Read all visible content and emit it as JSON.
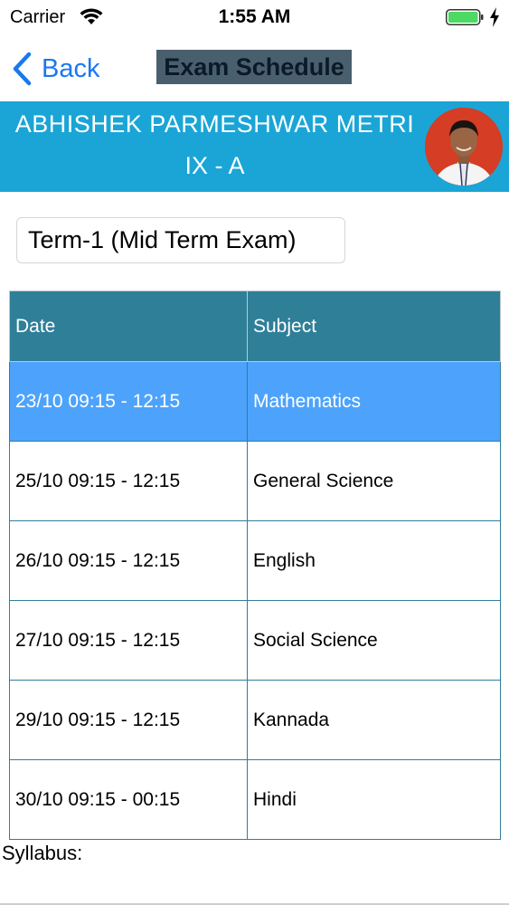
{
  "status_bar": {
    "carrier": "Carrier",
    "time": "1:55 AM"
  },
  "nav": {
    "back_label": "Back",
    "title": "Exam Schedule"
  },
  "profile": {
    "name": "ABHISHEK PARMESHWAR METRI",
    "class_section": "IX - A"
  },
  "term": {
    "selected": "Term-1 (Mid Term Exam)"
  },
  "table": {
    "headers": [
      "Date",
      "Subject"
    ],
    "rows": [
      {
        "date": "23/10 09:15 - 12:15",
        "subject": "Mathematics"
      },
      {
        "date": "25/10 09:15 - 12:15",
        "subject": "General Science"
      },
      {
        "date": "26/10 09:15 - 12:15",
        "subject": "English"
      },
      {
        "date": "27/10 09:15 - 12:15",
        "subject": "Social Science"
      },
      {
        "date": "29/10 09:15 - 12:15",
        "subject": "Kannada"
      },
      {
        "date": "30/10 09:15 - 00:15",
        "subject": "Hindi"
      }
    ]
  },
  "syllabus_label": "Syllabus:",
  "colors": {
    "accent_blue": "#1a78f0",
    "banner": "#1aa5d6",
    "table_header": "#2f7f99",
    "selected_row": "#4da3fb",
    "battery": "#4cd964"
  },
  "icons": [
    "wifi-icon",
    "battery-icon",
    "charging-bolt-icon",
    "chevron-left-icon"
  ]
}
